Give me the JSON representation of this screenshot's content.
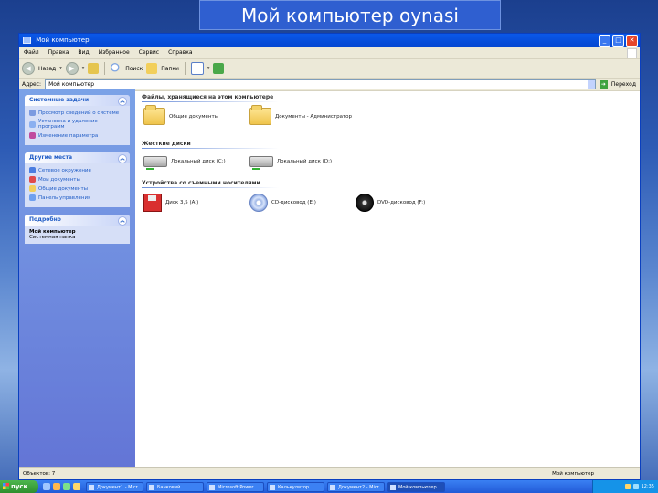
{
  "slide_title": "Мой компьютер oynasi",
  "window": {
    "title": "Мой компьютер",
    "buttons": {
      "minimize": "_",
      "maximize": "□",
      "close": "✕"
    }
  },
  "menubar": [
    "Файл",
    "Правка",
    "Вид",
    "Избранное",
    "Сервис",
    "Справка"
  ],
  "toolbar": {
    "back": "Назад",
    "folders": "Папки"
  },
  "address": {
    "label": "Адрес:",
    "value": "Мой компьютер",
    "go": "Переход"
  },
  "sidepanels": {
    "system_tasks": {
      "title": "Системные задачи",
      "items": [
        "Просмотр сведений о системе",
        "Установка и удаление программ",
        "Изменение параметра"
      ]
    },
    "other_places": {
      "title": "Другие места",
      "items": [
        "Сетевое окружение",
        "Мои документы",
        "Общие документы",
        "Панель управления"
      ]
    },
    "details": {
      "title": "Подробно",
      "name": "Мой компьютер",
      "type": "Системная папка"
    }
  },
  "groups": {
    "files": {
      "title": "Файлы, хранящиеся на этом компьютере",
      "items": [
        "Общие документы",
        "Документы - Администратор"
      ]
    },
    "hard_drives": {
      "title": "Жесткие диски",
      "items": [
        "Локальный диск (C:)",
        "Локальный диск (D:)"
      ]
    },
    "removable": {
      "title": "Устройства со съемными носителями",
      "items": [
        "Диск 3,5 (A:)",
        "CD-дисковод (E:)",
        "DVD-дисковод (F:)"
      ]
    }
  },
  "statusbar": {
    "left": "Объектов: 7",
    "right": "Мой компьютер"
  },
  "taskbar": {
    "start_label": "пуск",
    "tasks": [
      "Документ1 - Micr...",
      "Банковий",
      "Microsoft Power...",
      "Калькулятор",
      "Документ2 - Micr...",
      "Мой компьютер"
    ],
    "clock": "12:35"
  }
}
